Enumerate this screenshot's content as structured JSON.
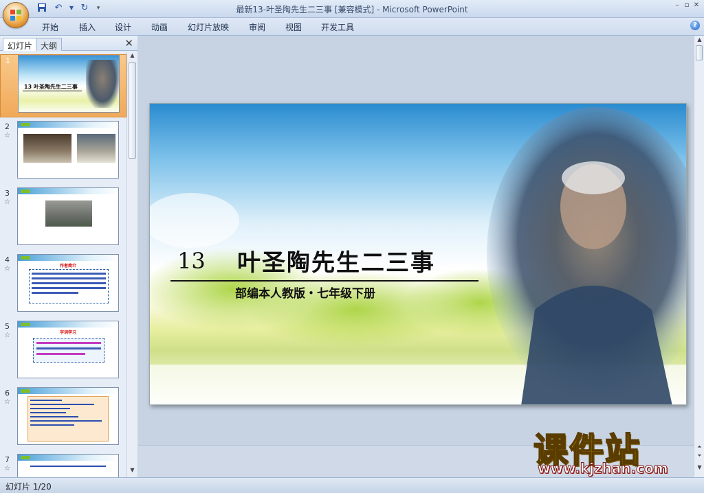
{
  "window": {
    "title": "最新13-叶圣陶先生二三事 [兼容模式] - Microsoft PowerPoint"
  },
  "ribbon": {
    "tabs": [
      "开始",
      "插入",
      "设计",
      "动画",
      "幻灯片放映",
      "审阅",
      "视图",
      "开发工具"
    ]
  },
  "left_panel": {
    "tab_slides": "幻灯片",
    "tab_outline": "大纲",
    "close": "✕"
  },
  "thumbnails": [
    {
      "num": "1",
      "selected": true,
      "title": "13 叶圣陶先生二三事"
    },
    {
      "num": "2",
      "selected": false,
      "star": "☆"
    },
    {
      "num": "3",
      "selected": false,
      "star": "☆"
    },
    {
      "num": "4",
      "selected": false,
      "star": "☆",
      "heading": "作者简介"
    },
    {
      "num": "5",
      "selected": false,
      "star": "☆",
      "heading": "字词学习"
    },
    {
      "num": "6",
      "selected": false,
      "star": "☆"
    },
    {
      "num": "7",
      "selected": false,
      "star": "☆"
    }
  ],
  "slide": {
    "number": "13",
    "title": "叶圣陶先生二三事",
    "subtitle": "部编本人教版・七年级下册"
  },
  "watermark": {
    "text": "课件站",
    "url": "www.kjzhan.com"
  },
  "status": {
    "slide_indicator": "幻灯片 1/20"
  },
  "colors": {
    "accent": "#2a5da8",
    "selected_thumb": "#f0a95a"
  }
}
